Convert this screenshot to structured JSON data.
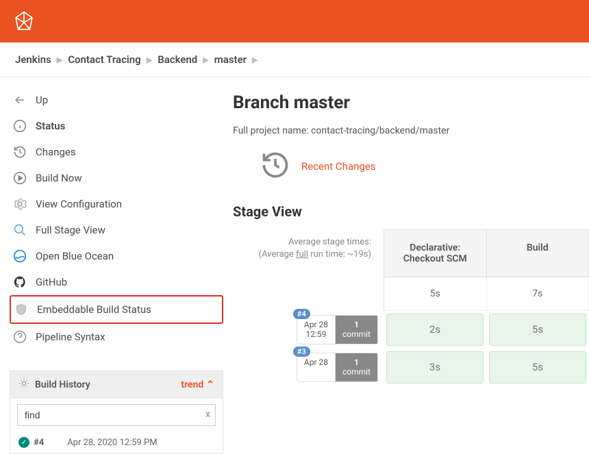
{
  "breadcrumbs": [
    "Jenkins",
    "Contact Tracing",
    "Backend",
    "master"
  ],
  "sidebar": {
    "items": [
      {
        "label": "Up"
      },
      {
        "label": "Status"
      },
      {
        "label": "Changes"
      },
      {
        "label": "Build Now"
      },
      {
        "label": "View Configuration"
      },
      {
        "label": "Full Stage View"
      },
      {
        "label": "Open Blue Ocean"
      },
      {
        "label": "GitHub"
      },
      {
        "label": "Embeddable Build Status"
      },
      {
        "label": "Pipeline Syntax"
      }
    ]
  },
  "buildHistory": {
    "title": "Build History",
    "trend": "trend",
    "searchValue": "find",
    "rows": [
      {
        "num": "#4",
        "date": "Apr 28, 2020 12:59 PM"
      }
    ]
  },
  "main": {
    "title": "Branch master",
    "fullName": "Full project name: contact-tracing/backend/master",
    "recentChanges": "Recent Changes",
    "stageView": "Stage View",
    "avgLine1": "Average stage times:",
    "avgLine2a": "(Average ",
    "avgLine2b": "full",
    "avgLine2c": " run time: ~19s)",
    "stages": [
      {
        "name": "Declarative: Checkout SCM",
        "avg": "5s"
      },
      {
        "name": "Build",
        "avg": "7s"
      }
    ],
    "builds": [
      {
        "num": "#4",
        "date": "Apr 28",
        "time": "12:59",
        "commits": "1",
        "commitLabel": "commit",
        "times": [
          "2s",
          "5s"
        ]
      },
      {
        "num": "#3",
        "date": "Apr 28",
        "time": "",
        "commits": "1",
        "commitLabel": "commit",
        "times": [
          "3s",
          "5s"
        ]
      }
    ]
  }
}
